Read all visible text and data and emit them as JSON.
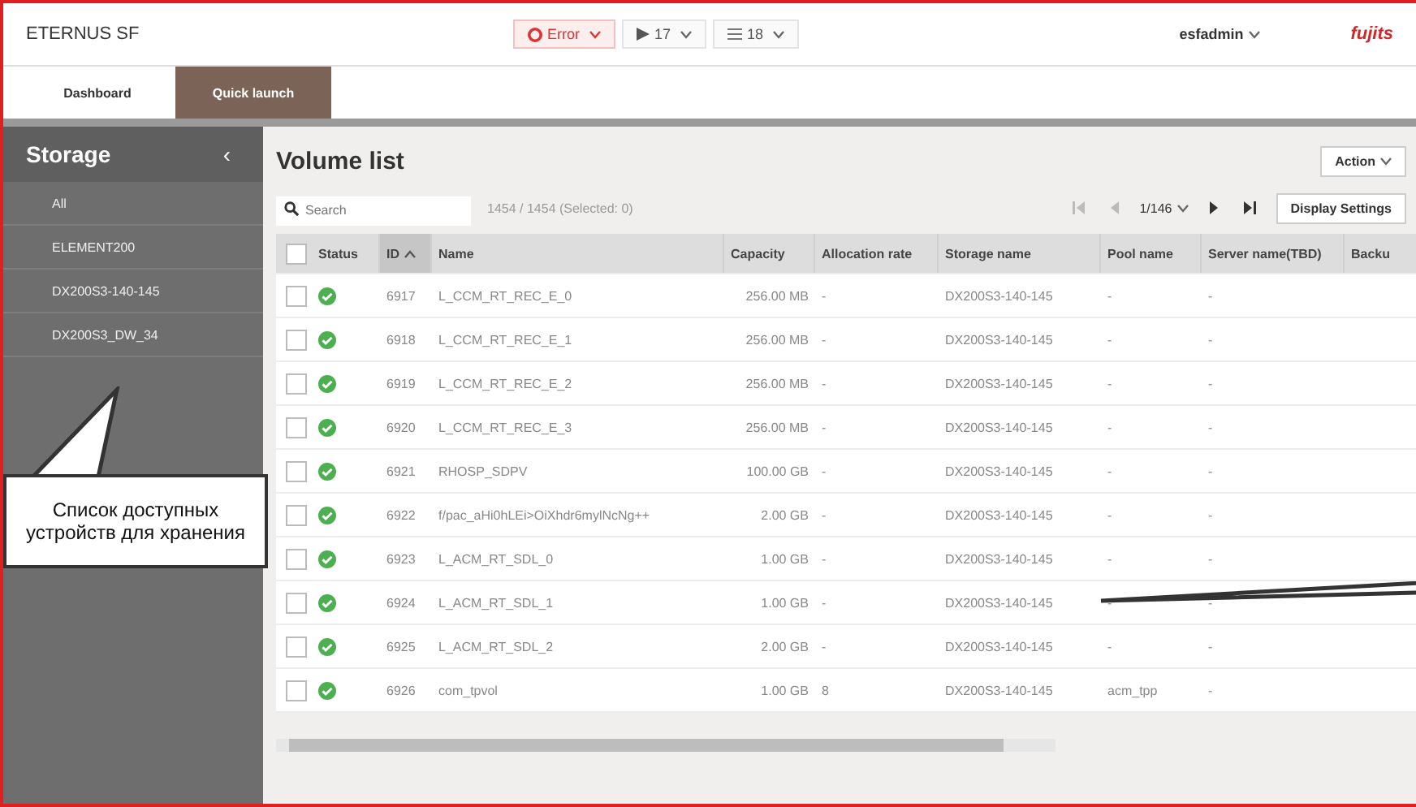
{
  "header": {
    "title": "ETERNUS SF",
    "alerts": [
      {
        "kind": "error",
        "label": "Error"
      },
      {
        "kind": "play",
        "label": "17"
      },
      {
        "kind": "list",
        "label": "18"
      }
    ],
    "user": "esfadmin",
    "logo": "fujits"
  },
  "tabs": [
    {
      "label": "Dashboard",
      "selected": false
    },
    {
      "label": "Quick launch",
      "selected": true
    }
  ],
  "sidebar": {
    "title": "Storage",
    "collapse": "‹",
    "items": [
      {
        "label": "All",
        "selected": false
      },
      {
        "label": "ELEMENT200",
        "selected": false
      },
      {
        "label": "DX200S3-140-145",
        "selected": false
      },
      {
        "label": "DX200S3_DW_34",
        "selected": false
      }
    ]
  },
  "content": {
    "title": "Volume list",
    "action": "Action",
    "search": {
      "placeholder": "Search"
    },
    "count": "1454 / 1454 (Selected: 0)",
    "page": "1/146",
    "display_settings": "Display Settings",
    "select_all_checked": false,
    "columns": [
      {
        "label": "Status",
        "sorted": false
      },
      {
        "label": "ID",
        "sorted": true
      },
      {
        "label": "Name",
        "sorted": false
      },
      {
        "label": "Capacity",
        "sorted": false
      },
      {
        "label": "Allocation rate",
        "sorted": false
      },
      {
        "label": "Storage name",
        "sorted": false
      },
      {
        "label": "Pool name",
        "sorted": false
      },
      {
        "label": "Server name(TBD)",
        "sorted": false
      },
      {
        "label": "Backu",
        "sorted": false
      }
    ],
    "rows": [
      {
        "checked": false,
        "ok": true,
        "id": "6917",
        "name": "L_CCM_RT_REC_E_0",
        "capacity": "256.00 MB",
        "allocation": "-",
        "storage": "DX200S3-140-145",
        "pool": "-",
        "server": "-"
      },
      {
        "checked": false,
        "ok": true,
        "id": "6918",
        "name": "L_CCM_RT_REC_E_1",
        "capacity": "256.00 MB",
        "allocation": "-",
        "storage": "DX200S3-140-145",
        "pool": "-",
        "server": "-"
      },
      {
        "checked": false,
        "ok": true,
        "id": "6919",
        "name": "L_CCM_RT_REC_E_2",
        "capacity": "256.00 MB",
        "allocation": "-",
        "storage": "DX200S3-140-145",
        "pool": "-",
        "server": "-"
      },
      {
        "checked": false,
        "ok": true,
        "id": "6920",
        "name": "L_CCM_RT_REC_E_3",
        "capacity": "256.00 MB",
        "allocation": "-",
        "storage": "DX200S3-140-145",
        "pool": "-",
        "server": "-"
      },
      {
        "checked": false,
        "ok": true,
        "id": "6921",
        "name": "RHOSP_SDPV",
        "capacity": "100.00 GB",
        "allocation": "-",
        "storage": "DX200S3-140-145",
        "pool": "-",
        "server": "-"
      },
      {
        "checked": false,
        "ok": true,
        "id": "6922",
        "name": "f/pac_aHi0hLEi>OiXhdr6mylNcNg++",
        "capacity": "2.00 GB",
        "allocation": "-",
        "storage": "DX200S3-140-145",
        "pool": "-",
        "server": "-"
      },
      {
        "checked": false,
        "ok": true,
        "id": "6923",
        "name": "L_ACM_RT_SDL_0",
        "capacity": "1.00 GB",
        "allocation": "-",
        "storage": "DX200S3-140-145",
        "pool": "-",
        "server": "-"
      },
      {
        "checked": false,
        "ok": true,
        "id": "6924",
        "name": "L_ACM_RT_SDL_1",
        "capacity": "1.00 GB",
        "allocation": "-",
        "storage": "DX200S3-140-145",
        "pool": "-",
        "server": "-"
      },
      {
        "checked": false,
        "ok": true,
        "id": "6925",
        "name": "L_ACM_RT_SDL_2",
        "capacity": "2.00 GB",
        "allocation": "-",
        "storage": "DX200S3-140-145",
        "pool": "-",
        "server": "-"
      },
      {
        "checked": false,
        "ok": true,
        "id": "6926",
        "name": "com_tpvol",
        "capacity": "1.00 GB",
        "allocation": "8",
        "storage": "DX200S3-140-145",
        "pool": "acm_tpp",
        "server": "-"
      }
    ]
  },
  "callout": {
    "text": "Список доступных устройств для хранения"
  }
}
